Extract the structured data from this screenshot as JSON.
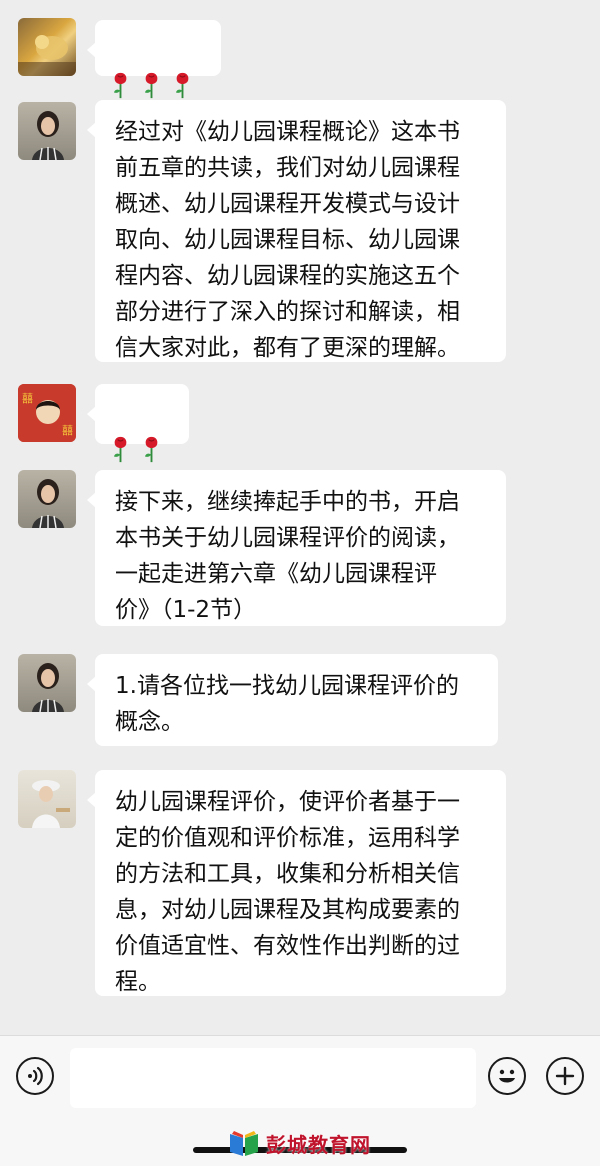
{
  "messages": [
    {
      "id": "m1",
      "type": "emoji",
      "roses": 3
    },
    {
      "id": "m2",
      "type": "text",
      "text": "经过对《幼儿园课程概论》这本书\n前五章的共读，我们对幼儿园课程\n概述、幼儿园课程开发模式与设计\n取向、幼儿园课程目标、幼儿园课\n程内容、幼儿园课程的实施这五个\n部分进行了深入的探讨和解读，相\n信大家对此，都有了更深的理解。"
    },
    {
      "id": "m3",
      "type": "emoji",
      "roses": 2
    },
    {
      "id": "m4",
      "type": "text",
      "text": "接下来，继续捧起手中的书，开启\n本书关于幼儿园课程评价的阅读，\n一起走进第六章《幼儿园课程评\n价》（1-2节）"
    },
    {
      "id": "m5",
      "type": "text",
      "text": "1.请各位找一找幼儿园课程评价的\n概念。"
    },
    {
      "id": "m6",
      "type": "text",
      "text": "幼儿园课程评价，使评价者基于一\n定的价值观和评价标准，运用科学\n的方法和工具，收集和分析相关信\n息，对幼儿园课程及其构成要素的\n价值适宜性、有效性作出判断的过\n程。"
    }
  ],
  "input_bar": {
    "voice_icon": "voice-icon",
    "emoji_icon": "emoji-icon",
    "plus_icon": "plus-icon",
    "input_value": ""
  },
  "watermark": {
    "text": "彭城教育网"
  },
  "colors": {
    "background": "#ededed",
    "bubble": "#ffffff",
    "watermark_red": "#c0142c"
  }
}
